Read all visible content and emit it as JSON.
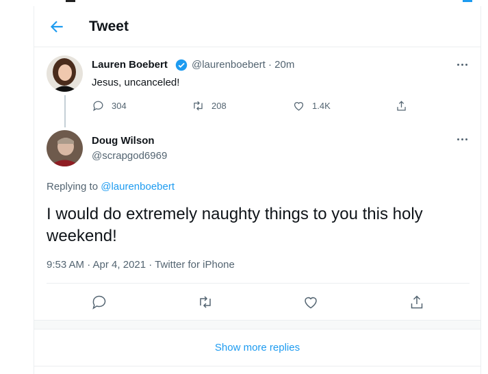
{
  "header": {
    "title": "Tweet"
  },
  "parent_tweet": {
    "name": "Lauren Boebert",
    "handle_time": "@laurenboebert · 20m",
    "text": "Jesus, uncanceled!",
    "replies": "304",
    "retweets": "208",
    "likes": "1.4K"
  },
  "reply_tweet": {
    "name": "Doug Wilson",
    "handle": "@scrapgod6969",
    "replying_prefix": "Replying to ",
    "replying_to": "@laurenboebert",
    "text": "I would do extremely naughty things to you this holy weekend!",
    "timestamp": "9:53 AM · Apr 4, 2021 · Twitter for iPhone"
  },
  "show_more": "Show more replies",
  "colors": {
    "accent": "#1d9bf0",
    "muted": "#536471",
    "border": "#ebeef0"
  },
  "icons": [
    "back-arrow-icon",
    "verified-badge-icon",
    "more-icon",
    "reply-icon",
    "retweet-icon",
    "like-icon",
    "share-icon"
  ]
}
